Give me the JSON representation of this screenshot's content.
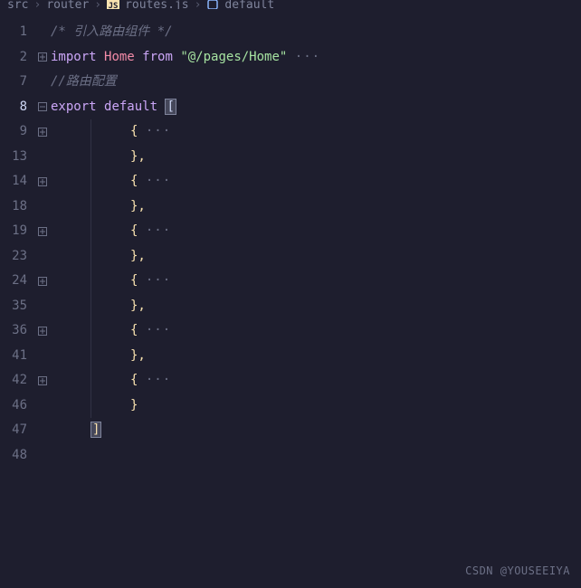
{
  "breadcrumb": {
    "seg1": "src",
    "seg2": "router",
    "seg3": "routes.js",
    "seg4": "default",
    "sep": "›"
  },
  "lines": {
    "n1": "1",
    "n2": "2",
    "n7": "7",
    "n8": "8",
    "n9": "9",
    "n13": "13",
    "n14": "14",
    "n18": "18",
    "n19": "19",
    "n23": "23",
    "n24": "24",
    "n35": "35",
    "n36": "36",
    "n41": "41",
    "n42": "42",
    "n46": "46",
    "n47": "47",
    "n48": "48"
  },
  "code": {
    "comment1": "/* 引入路由组件 */",
    "import_kw": "import",
    "home": "Home",
    "from_kw": "from",
    "home_path": "\"@/pages/Home\"",
    "dots": "···",
    "comment2": "//路由配置",
    "export_kw": "export",
    "default_kw": "default",
    "open_bracket": "[",
    "close_bracket": "]",
    "open_brace": "{",
    "close_brace_comma": "},",
    "close_brace": "}"
  },
  "watermark": "CSDN @YOUSEEIYA"
}
